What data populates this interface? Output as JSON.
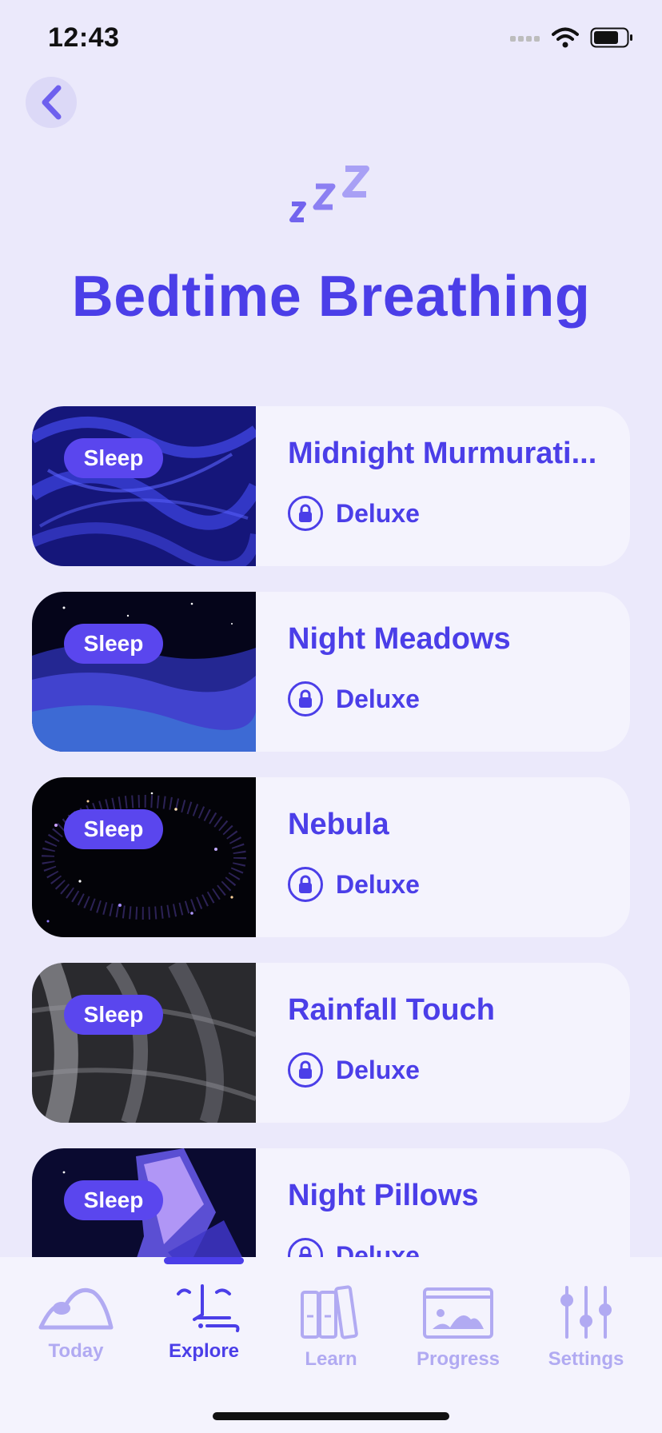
{
  "status": {
    "time": "12:43"
  },
  "header": {
    "title": "Bedtime Breathing"
  },
  "items": [
    {
      "badge": "Sleep",
      "title": "Midnight Murmurati...",
      "tier": "Deluxe"
    },
    {
      "badge": "Sleep",
      "title": "Night Meadows",
      "tier": "Deluxe"
    },
    {
      "badge": "Sleep",
      "title": "Nebula",
      "tier": "Deluxe"
    },
    {
      "badge": "Sleep",
      "title": "Rainfall Touch",
      "tier": "Deluxe"
    },
    {
      "badge": "Sleep",
      "title": "Night Pillows",
      "tier": "Deluxe"
    }
  ],
  "tabs": [
    {
      "label": "Today",
      "icon": "mountain-icon"
    },
    {
      "label": "Explore",
      "icon": "explore-figure-icon"
    },
    {
      "label": "Learn",
      "icon": "books-icon"
    },
    {
      "label": "Progress",
      "icon": "picture-icon"
    },
    {
      "label": "Settings",
      "icon": "sliders-icon"
    }
  ],
  "colors": {
    "accent": "#4b3ee8",
    "background": "#ebe9fb",
    "card": "#f4f3fd",
    "inactive_tab": "#b1aaf2"
  }
}
